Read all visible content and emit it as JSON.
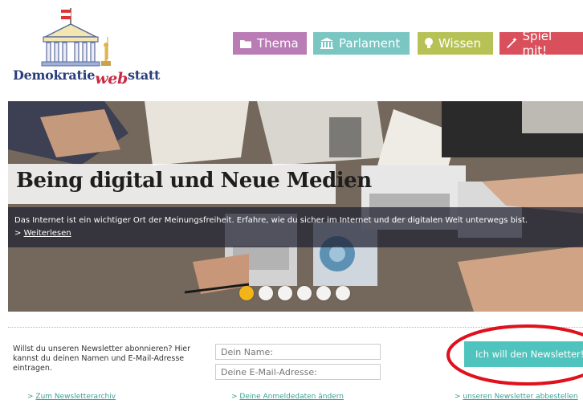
{
  "brand": {
    "logo_text_before": "Demokratie",
    "logo_text_web": "web",
    "logo_text_after": "statt"
  },
  "nav": {
    "items": [
      {
        "label": "Thema",
        "icon": "folder-icon",
        "color": "#b97cb5"
      },
      {
        "label": "Parlament",
        "icon": "parliament-icon",
        "color": "#7ac6c3"
      },
      {
        "label": "Wissen",
        "icon": "lightbulb-icon",
        "color": "#b7c256"
      },
      {
        "label": "Spiel mit!",
        "icon": "magic-wand-icon",
        "color": "#d9505c"
      }
    ]
  },
  "hero": {
    "title": "Being digital und Neue Medien",
    "description": "Das Internet ist ein wichtiger Ort der Meinungsfreiheit. Erfahre, wie du sicher im Internet und der digitalen Welt unterwegs bist.",
    "more_prefix": "> ",
    "more_label": "Weiterlesen",
    "slides_total": 6,
    "slide_active": 1,
    "accent": "#f2b418"
  },
  "newsletter": {
    "intro": "Willst du unseren Newsletter abonnieren? Hier kannst du deinen Namen und E-Mail-Adresse eintragen.",
    "name_placeholder": "Dein Name:",
    "email_placeholder": "Deine E-Mail-Adresse:",
    "button_label": "Ich will den Newsletter!",
    "button_color": "#4fc3bd",
    "highlight_color": "#e0101c",
    "links": {
      "archive": "Zum Newsletterarchiv",
      "change": "Deine Anmeldedaten ändern",
      "cancel": "unseren Newsletter abbestellen"
    },
    "link_prefix": "> "
  }
}
